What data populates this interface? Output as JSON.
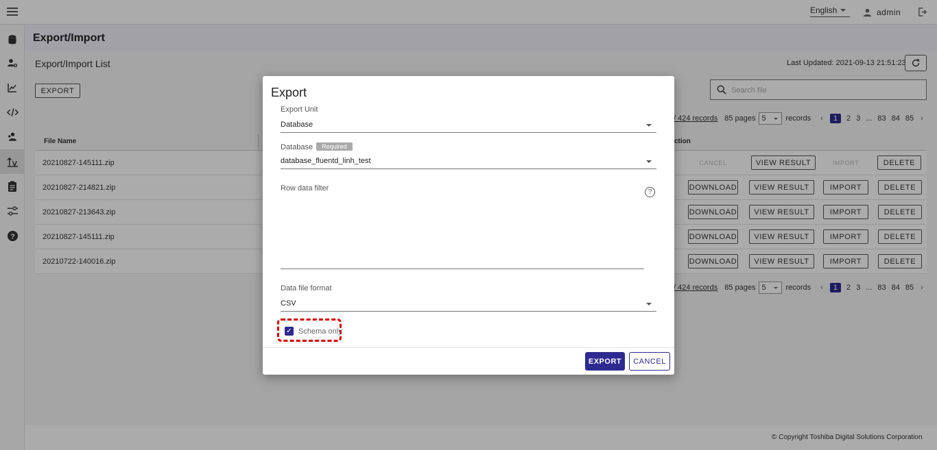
{
  "topbar": {
    "language": "English",
    "user": "admin"
  },
  "sidebar": {
    "items": [
      {
        "icon": "database-icon"
      },
      {
        "icon": "user-settings-icon"
      },
      {
        "icon": "chart-icon"
      },
      {
        "icon": "code-icon"
      },
      {
        "icon": "users-icon"
      },
      {
        "icon": "export-import-icon",
        "active": true
      },
      {
        "icon": "clipboard-icon"
      },
      {
        "icon": "settings-sliders-icon"
      },
      {
        "icon": "help-icon"
      }
    ]
  },
  "page": {
    "title": "Export/Import",
    "list_title": "Export/Import List",
    "last_updated": "Last Updated: 2021-09-13 21:51:23",
    "export_button": "EXPORT",
    "search_placeholder": "Search file"
  },
  "pagination": {
    "records_link": "/ 424 records",
    "pages_text": "85 pages",
    "page_size": "5",
    "records_label": "records",
    "pages": [
      "1",
      "2",
      "3",
      "...",
      "83",
      "84",
      "85"
    ],
    "current": "1"
  },
  "table": {
    "headers": {
      "file_name": "File Name",
      "action": "ction"
    },
    "rows": [
      {
        "file": "20210827-145111.zip",
        "btn1": "CANCEL",
        "btn2": "VIEW RESULT",
        "btn3": "IMPORT",
        "btn4": "DELETE",
        "pending": true
      },
      {
        "file": "20210827-214821.zip",
        "btn1": "DOWNLOAD",
        "btn2": "VIEW RESULT",
        "btn3": "IMPORT",
        "btn4": "DELETE"
      },
      {
        "file": "20210827-213643.zip",
        "btn1": "DOWNLOAD",
        "btn2": "VIEW RESULT",
        "btn3": "IMPORT",
        "btn4": "DELETE"
      },
      {
        "file": "20210827-145111.zip",
        "btn1": "DOWNLOAD",
        "btn2": "VIEW RESULT",
        "btn3": "IMPORT",
        "btn4": "DELETE"
      },
      {
        "file": "20210722-140016.zip",
        "btn1": "DOWNLOAD",
        "btn2": "VIEW RESULT",
        "btn3": "IMPORT",
        "btn4": "DELETE"
      }
    ]
  },
  "dialog": {
    "title": "Export",
    "export_unit_label": "Export Unit",
    "export_unit_value": "Database",
    "database_label": "Database",
    "required_badge": "Required",
    "database_value": "database_fluentd_linh_test",
    "row_filter_label": "Row data filter",
    "help_glyph": "?",
    "format_label": "Data file format",
    "format_value": "CSV",
    "schema_only_label": "Schema only",
    "schema_only_checked": true,
    "export_button": "EXPORT",
    "cancel_button": "CANCEL"
  },
  "footer": {
    "copyright": "© Copyright Toshiba Digital Solutions Corporation"
  },
  "colors": {
    "primary": "#2e2a8f",
    "highlight": "#d00000"
  }
}
